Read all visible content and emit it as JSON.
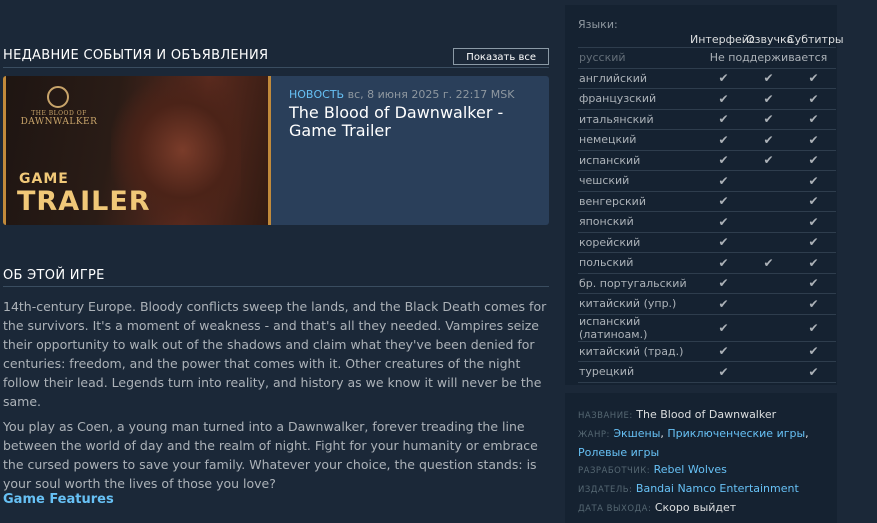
{
  "events": {
    "title": "НЕДАВНИЕ СОБЫТИЯ И ОБЪЯВЛЕНИЯ",
    "show_all": "Показать все",
    "card": {
      "logo_top": "THE BLOOD OF",
      "logo_name": "DAWNWALKER",
      "thumb_word1": "GAME",
      "thumb_word2": "TRAILER",
      "tag": "НОВОСТЬ",
      "date": "вс, 8 июня 2025 г. 22:17 MSK",
      "title": "The Blood of Dawnwalker - Game Trailer"
    }
  },
  "about": {
    "title": "ОБ ЭТОЙ ИГРЕ",
    "paragraphs": [
      "14th-century Europe. Bloody conflicts sweep the lands, and the Black Death comes for the survivors. It's a moment of weakness - and that's all they needed. Vampires seize their opportunity to walk out of the shadows and claim what they've been denied for centuries: freedom, and the power that comes with it. Other creatures of the night follow their lead. Legends turn into reality, and history as we know it will never be the same.",
      "You play as Coen, a young man turned into a Dawnwalker, forever treading the line between the world of day and the realm of night. Fight for your humanity or embrace the cursed powers to save your family. Whatever your choice, the question stands: is your soul worth the lives of those you love?"
    ],
    "features_link": "Game Features"
  },
  "languages": {
    "title": "Языки:",
    "col_interface": "Интерфейс",
    "col_voice": "Озвучка",
    "col_subtitles": "Субтитры",
    "not_supported": "Не поддерживается",
    "check_glyph": "✔",
    "rows": [
      {
        "name": "русский",
        "supported": false
      },
      {
        "name": "английский",
        "interface": true,
        "voice": true,
        "subtitles": true
      },
      {
        "name": "французский",
        "interface": true,
        "voice": true,
        "subtitles": true
      },
      {
        "name": "итальянский",
        "interface": true,
        "voice": true,
        "subtitles": true
      },
      {
        "name": "немецкий",
        "interface": true,
        "voice": true,
        "subtitles": true
      },
      {
        "name": "испанский",
        "interface": true,
        "voice": true,
        "subtitles": true
      },
      {
        "name": "чешский",
        "interface": true,
        "voice": false,
        "subtitles": true
      },
      {
        "name": "венгерский",
        "interface": true,
        "voice": false,
        "subtitles": true
      },
      {
        "name": "японский",
        "interface": true,
        "voice": false,
        "subtitles": true
      },
      {
        "name": "корейский",
        "interface": true,
        "voice": false,
        "subtitles": true
      },
      {
        "name": "польский",
        "interface": true,
        "voice": true,
        "subtitles": true
      },
      {
        "name": "бр. португальский",
        "interface": true,
        "voice": false,
        "subtitles": true
      },
      {
        "name": "китайский (упр.)",
        "interface": true,
        "voice": false,
        "subtitles": true
      },
      {
        "name": "испанский (латиноам.)",
        "interface": true,
        "voice": false,
        "subtitles": true
      },
      {
        "name": "китайский (трад.)",
        "interface": true,
        "voice": false,
        "subtitles": true
      },
      {
        "name": "турецкий",
        "interface": true,
        "voice": false,
        "subtitles": true
      }
    ]
  },
  "info": {
    "name_label": "НАЗВАНИЕ:",
    "name_value": "The Blood of Dawnwalker",
    "genre_label": "ЖАНР:",
    "genres": [
      "Экшены",
      "Приключенческие игры",
      "Ролевые игры"
    ],
    "developer_label": "РАЗРАБОТЧИК:",
    "developer": "Rebel Wolves",
    "publisher_label": "ИЗДАТЕЛЬ:",
    "publisher": "Bandai Namco Entertainment",
    "release_label": "ДАТА ВЫХОДА:",
    "release_value": "Скоро выйдет"
  },
  "colors": {
    "background": "#1b2838",
    "panel": "#152231",
    "link": "#67c1f5",
    "accent_gold": "#f0c878"
  }
}
